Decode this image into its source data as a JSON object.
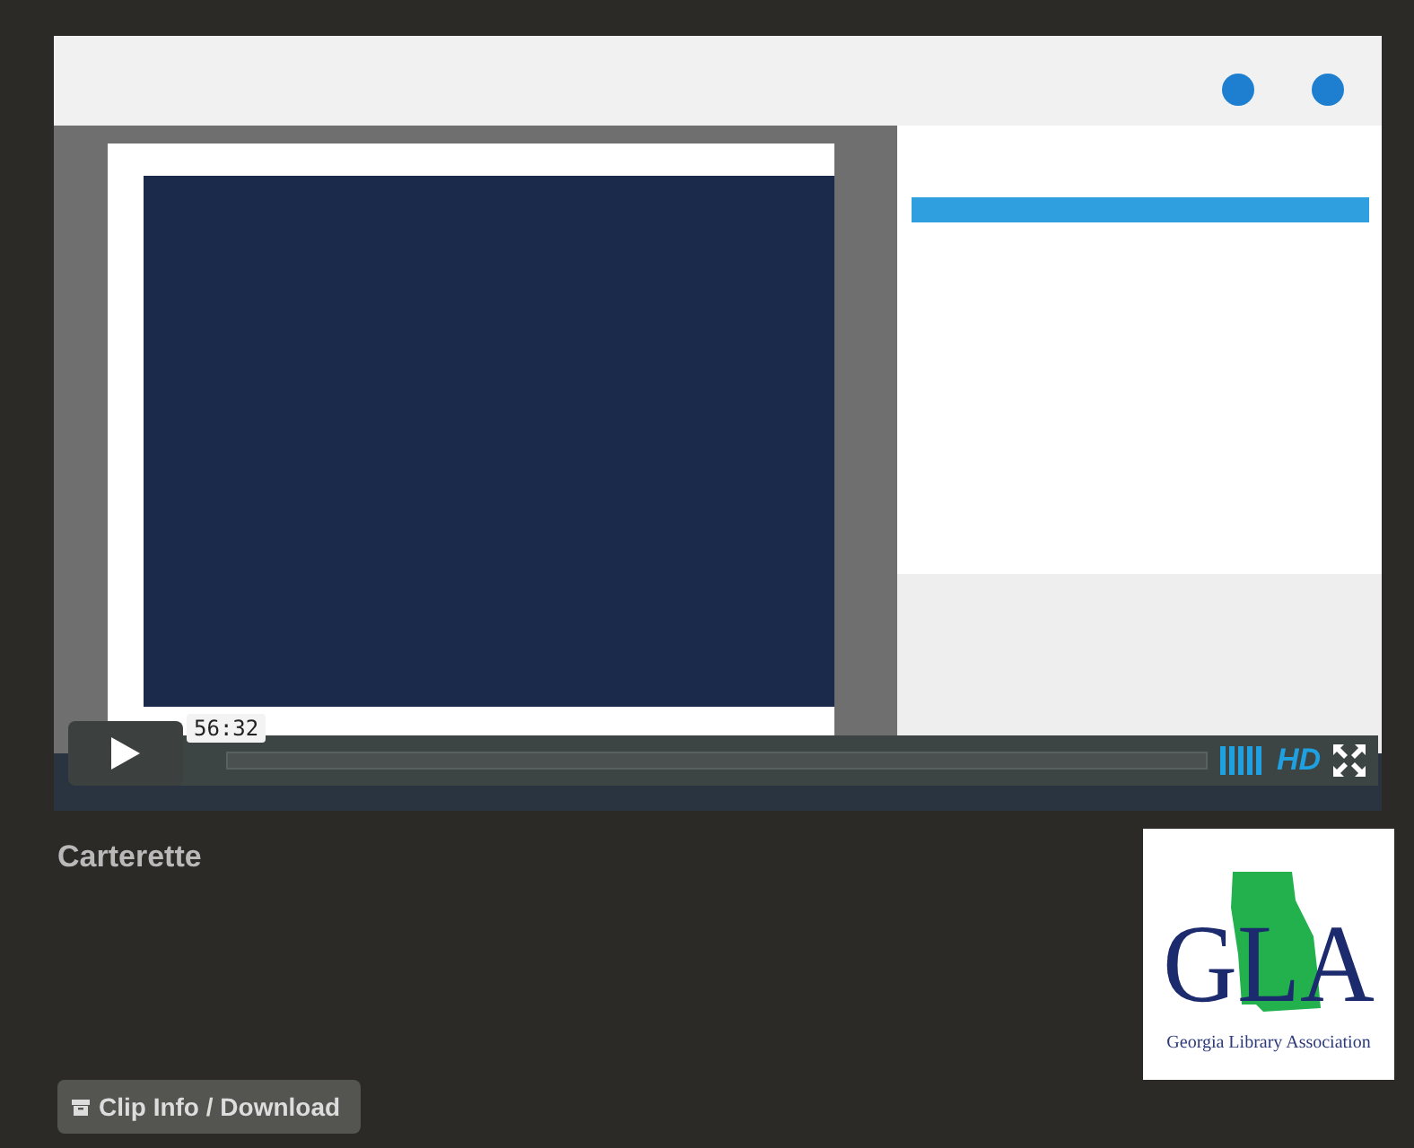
{
  "player": {
    "time": "56:32",
    "hd_label": "HD",
    "progress": {
      "level": 0
    }
  },
  "clip_title": "Carterette",
  "logo": {
    "letters": "GLA",
    "caption": "Georgia Library Association"
  },
  "buttons": [
    {
      "label": "Clip Info / Download"
    }
  ]
}
